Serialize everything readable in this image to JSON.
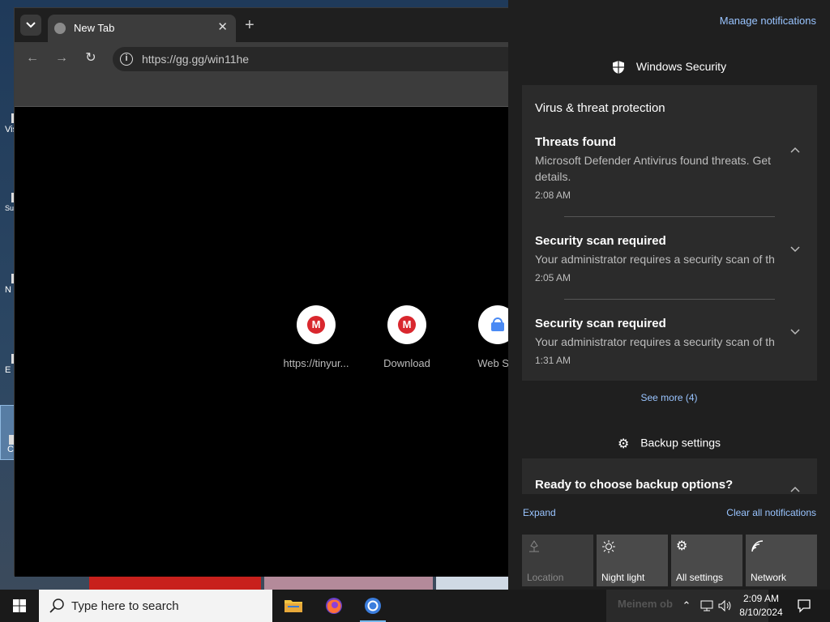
{
  "browser": {
    "tab_title": "New Tab",
    "url": "https://gg.gg/win11he",
    "shortcuts": [
      {
        "label": "https://tinyur..."
      },
      {
        "label": "Download"
      },
      {
        "label": "Web Sto"
      }
    ]
  },
  "desktop_icons": [
    "Vis",
    "Su",
    "N",
    "E",
    "C"
  ],
  "action_center": {
    "manage_label": "Manage notifications",
    "security_group": "Windows Security",
    "security_card_title": "Virus & threat protection",
    "notifications": [
      {
        "heading": "Threats found",
        "body": "Microsoft Defender Antivirus found threats. Get details.",
        "time": "2:08 AM"
      },
      {
        "heading": "Security scan required",
        "body": "Your administrator requires a security scan of th",
        "time": "2:05 AM"
      },
      {
        "heading": "Security scan required",
        "body": "Your administrator requires a security scan of th",
        "time": "1:31 AM"
      }
    ],
    "see_more": "See more (4)",
    "backup_group": "Backup settings",
    "backup_card_title": "Ready to choose backup options?",
    "expand": "Expand",
    "clear_all": "Clear all notifications",
    "quick_actions": [
      {
        "label": "Location",
        "icon": "location-icon",
        "enabled": false
      },
      {
        "label": "Night light",
        "icon": "brightness-icon",
        "enabled": true
      },
      {
        "label": "All settings",
        "icon": "gear-icon",
        "enabled": true
      },
      {
        "label": "Network",
        "icon": "network-icon",
        "enabled": true
      }
    ]
  },
  "taskbar": {
    "search_placeholder": "Type here to search",
    "time": "2:09 AM",
    "date": "8/10/2024",
    "tray_text": "Meinem ob"
  },
  "colors": {
    "link": "#99c4ff",
    "accent": "#76b9ed",
    "mega_red": "#d9272e"
  }
}
